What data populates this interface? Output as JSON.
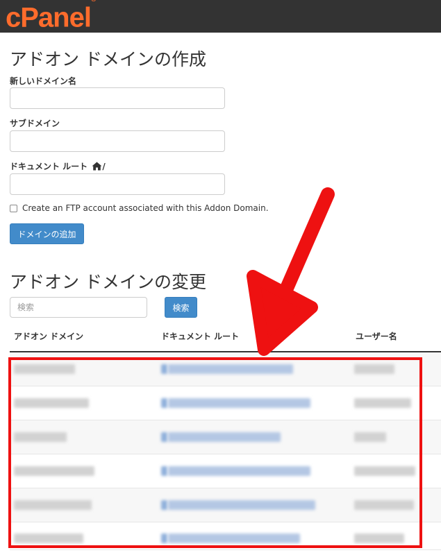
{
  "header": {
    "logo_text": "cPanel",
    "logo_mark": "®",
    "bg_color": "#333333",
    "logo_color": "#ff6c2c"
  },
  "create_section": {
    "title": "アドオン ドメインの作成",
    "new_domain_label": "新しいドメイン名",
    "new_domain_value": "",
    "subdomain_label": "サブドメイン",
    "subdomain_value": "",
    "docroot_label": "ドキュメント ルート",
    "docroot_suffix": "/",
    "docroot_value": "",
    "ftp_checkbox_label": "Create an FTP account associated with this Addon Domain.",
    "ftp_checked": false,
    "submit_label": "ドメインの追加"
  },
  "modify_section": {
    "title": "アドオン ドメインの変更",
    "search_placeholder": "検索",
    "search_button": "検索",
    "columns": [
      "アドオン ドメイン",
      "ドキュメント ルート",
      "ユーザー名"
    ],
    "rows_note_count": 6
  },
  "annotations": {
    "arrow_color": "#ee1111",
    "highlight_color": "#ee1111"
  },
  "accent_color": "#428bca"
}
